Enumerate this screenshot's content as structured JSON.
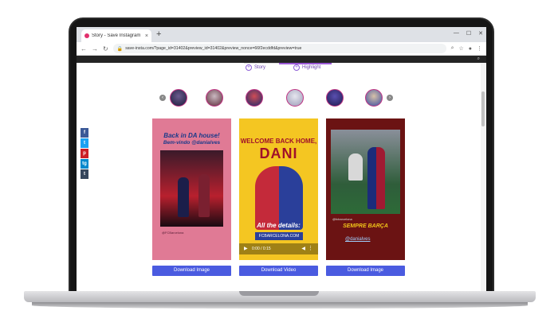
{
  "browser": {
    "tab_title": "Story - Save Instagram",
    "tab_close": "×",
    "new_tab": "+",
    "url": "save-insta.com/?page_id=31402&preview_id=31402&preview_nonce=66f2ecddfd&preview=true"
  },
  "page": {
    "tabs": [
      {
        "label": "Story",
        "icon": "plus-circle-icon"
      },
      {
        "label": "Highlight",
        "icon": "plus-circle-icon"
      }
    ],
    "social_share": [
      "f",
      "t",
      "p",
      "tg",
      "t"
    ],
    "cards": [
      {
        "bg": "#e07a95",
        "headline1": "Back in DA house!",
        "headline2": "Bem-vindo @danialves",
        "caption": "@FCBarcelona",
        "button": "Download Image"
      },
      {
        "bg": "#f4c622",
        "headline1": "WELCOME BACK HOME,",
        "headline2": "DANI",
        "sub1": "All the details:",
        "sub2": "FCBARCELONA.COM",
        "time": "0:00 / 0:15",
        "button": "Download Video"
      },
      {
        "bg": "#6b1313",
        "caption": "@fcbarcelona",
        "headline1": "SEMPRE BARÇA",
        "mention": "@danialves",
        "button": "Download Image"
      }
    ]
  },
  "colors": {
    "accent": "#9b59d6",
    "button": "#4a5be0"
  }
}
